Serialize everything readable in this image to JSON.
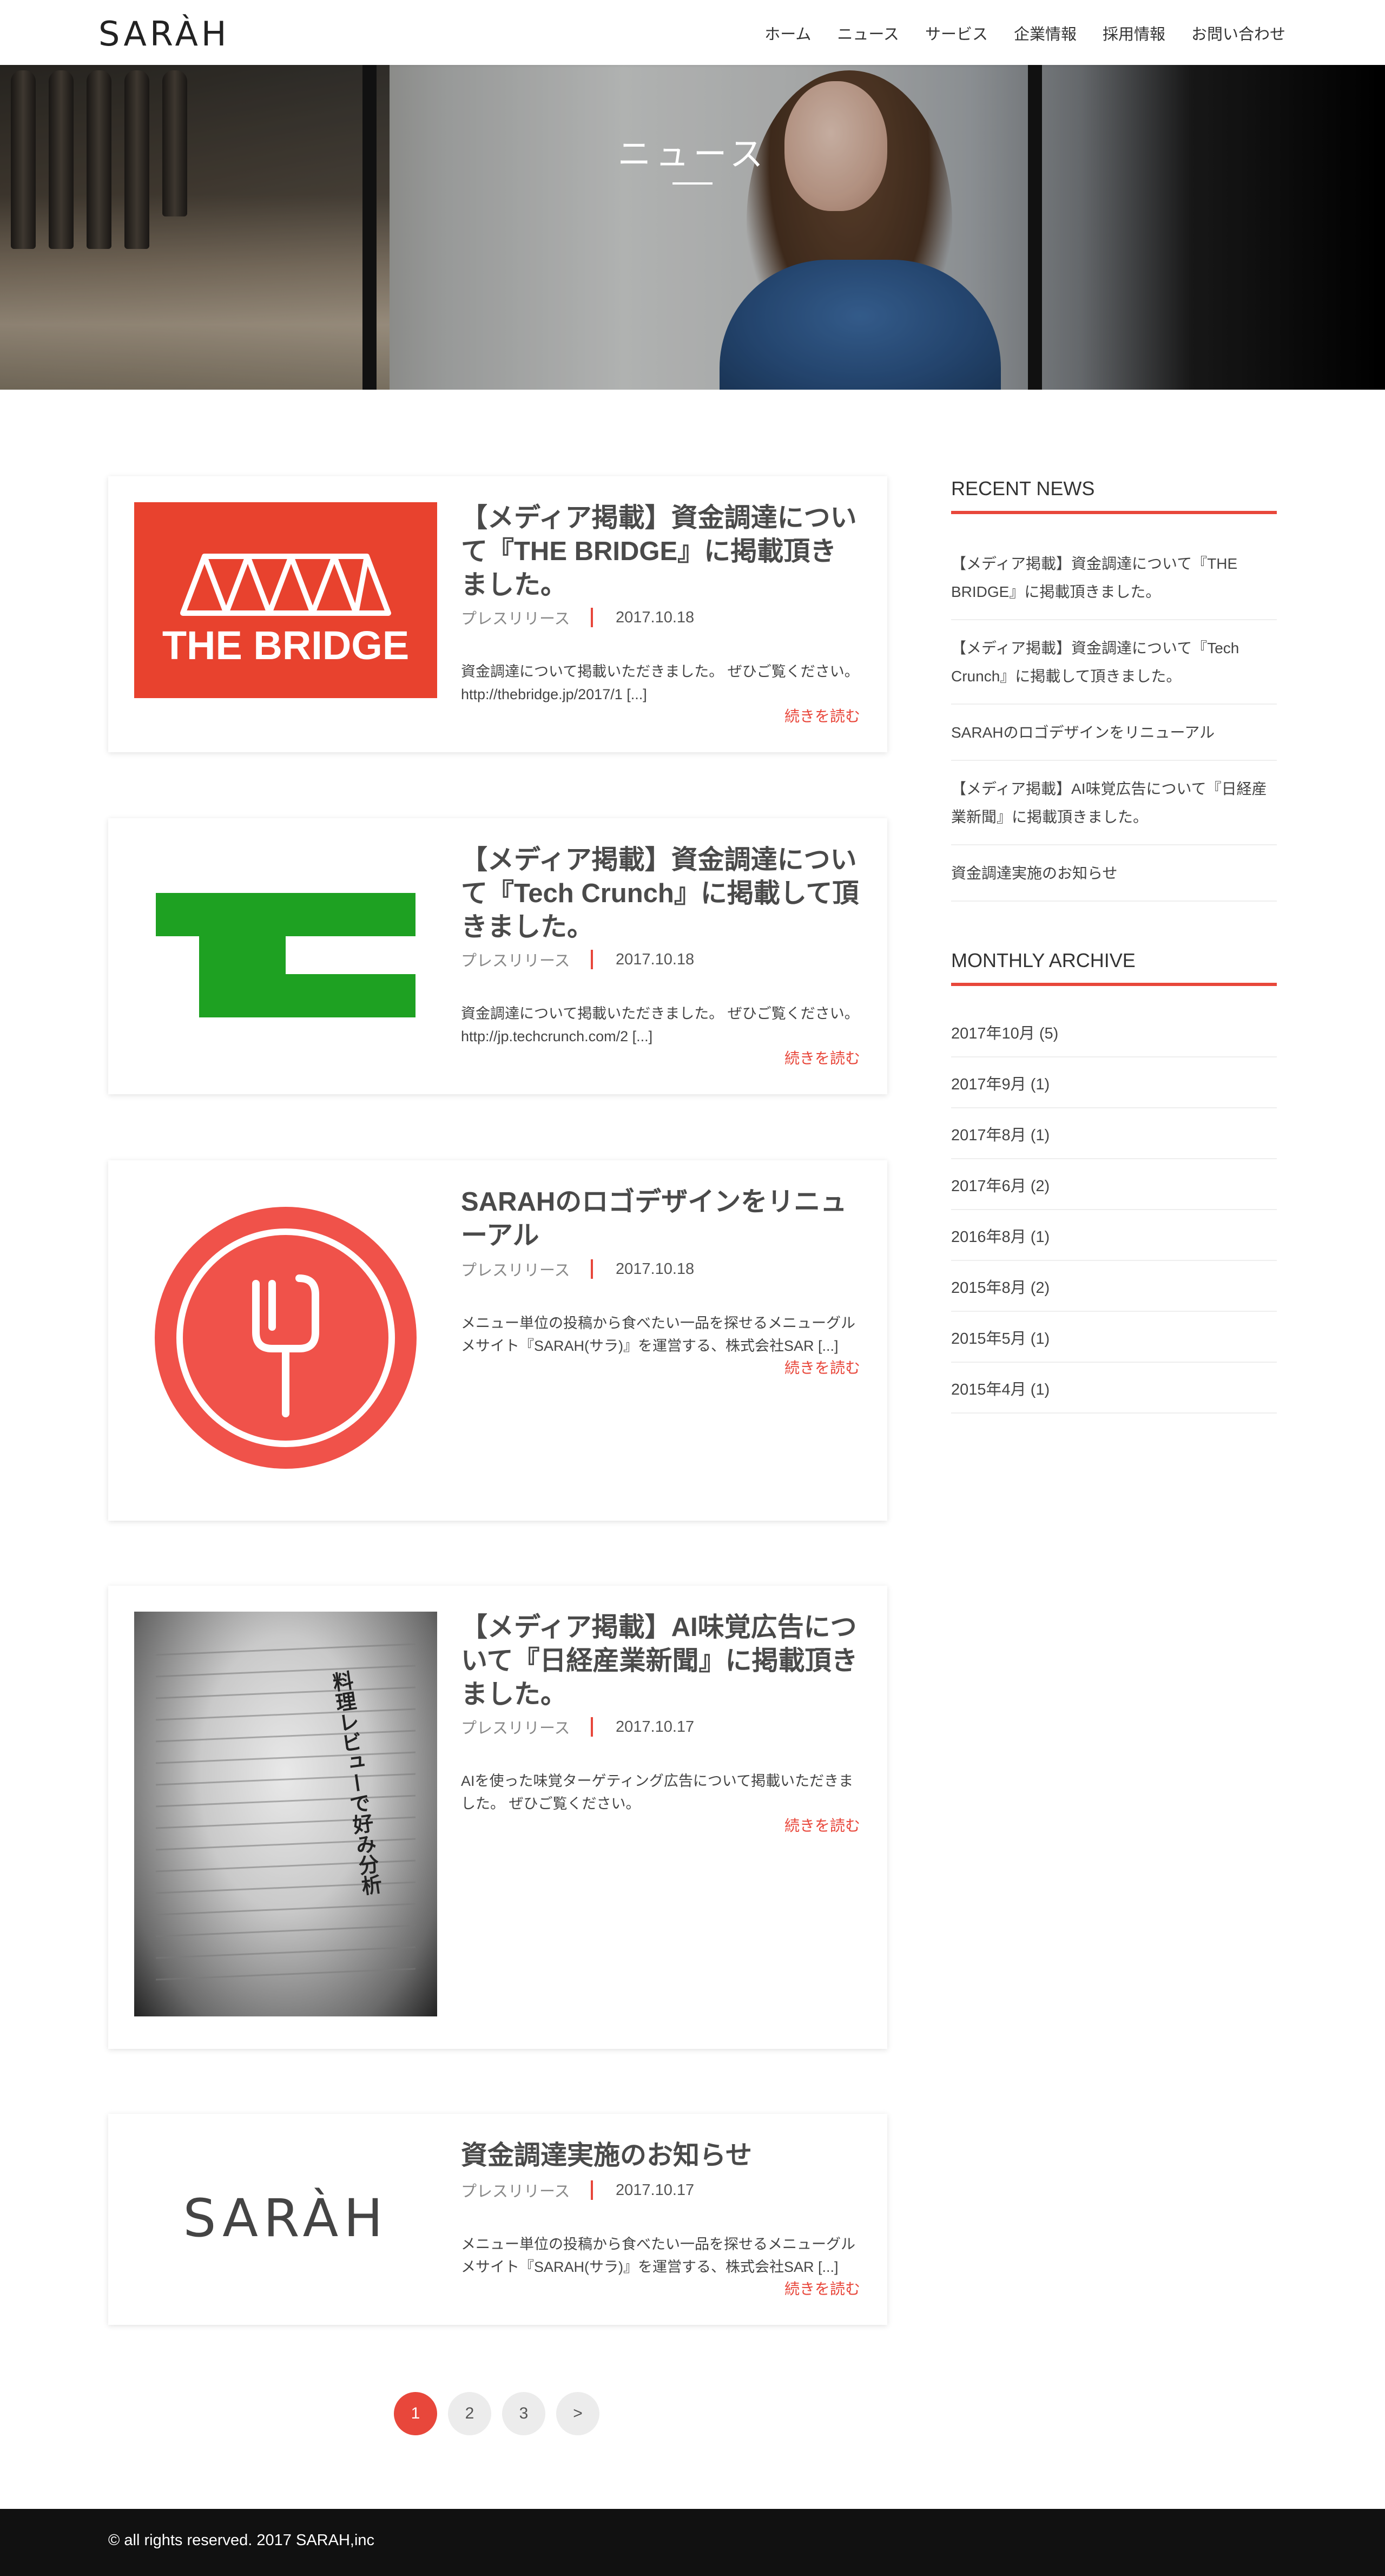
{
  "site": {
    "logo": "SARÀH"
  },
  "nav": {
    "items": [
      "ホーム",
      "ニュース",
      "サービス",
      "企業情報",
      "採用情報",
      "お問い合わせ"
    ]
  },
  "hero": {
    "title": "ニュース"
  },
  "posts": [
    {
      "title": "【メディア掲載】資金調達について『THE BRIDGE』に掲載頂きました。",
      "category": "プレスリリース",
      "date": "2017.10.18",
      "excerpt": "資金調達について掲載いただきました。 ぜひご覧ください。 http://thebridge.jp/2017/1 [...]",
      "more": "続きを読む",
      "thumb_text": "THE BRIDGE",
      "thumb_color": "#e8422e"
    },
    {
      "title": "【メディア掲載】資金調達について『Tech Crunch』に掲載して頂きました。",
      "category": "プレスリリース",
      "date": "2017.10.18",
      "excerpt": "資金調達について掲載いただきました。 ぜひご覧ください。 http://jp.techcrunch.com/2 [...]",
      "more": "続きを読む",
      "thumb_color": "#1ea122"
    },
    {
      "title": "SARAHのロゴデザインをリニューアル",
      "category": "プレスリリース",
      "date": "2017.10.18",
      "excerpt": "メニュー単位の投稿から食べたい一品を探せるメニューグルメサイト『SARAH(サラ)』を運営する、株式会社SAR [...]",
      "more": "続きを読む",
      "thumb_color": "#f0524a"
    },
    {
      "title": "【メディア掲載】AI味覚広告について『日経産業新聞』に掲載頂きました。",
      "category": "プレスリリース",
      "date": "2017.10.17",
      "excerpt": "AIを使った味覚ターゲティング広告について掲載いただきました。 ぜひご覧ください。",
      "more": "続きを読む",
      "thumb_text": "料理レビューで好み分析"
    },
    {
      "title": "資金調達実施のお知らせ",
      "category": "プレスリリース",
      "date": "2017.10.17",
      "excerpt": "メニュー単位の投稿から食べたい一品を探せるメニューグルメサイト『SARAH(サラ)』を運営する、株式会社SAR [...]",
      "more": "続きを読む",
      "thumb_text": "SARÀH"
    }
  ],
  "sidebar": {
    "recent_heading": "RECENT NEWS",
    "recent": [
      "【メディア掲載】資金調達について『THE BRIDGE』に掲載頂きました。",
      "【メディア掲載】資金調達について『Tech Crunch』に掲載して頂きました。",
      "SARAHのロゴデザインをリニューアル",
      "【メディア掲載】AI味覚広告について『日経産業新聞』に掲載頂きました。",
      "資金調達実施のお知らせ"
    ],
    "archive_heading": "MONTHLY ARCHIVE",
    "archive": [
      "2017年10月 (5)",
      "2017年9月 (1)",
      "2017年8月 (1)",
      "2017年6月 (2)",
      "2016年8月 (1)",
      "2015年8月 (2)",
      "2015年5月 (1)",
      "2015年4月 (1)"
    ]
  },
  "pagination": {
    "pages": [
      "1",
      "2",
      "3",
      ">"
    ],
    "current": "1"
  },
  "footer": {
    "text": "© all rights reserved. 2017 SARAH,inc"
  },
  "colors": {
    "accent": "#e8473b",
    "footer_bg": "#111111"
  }
}
